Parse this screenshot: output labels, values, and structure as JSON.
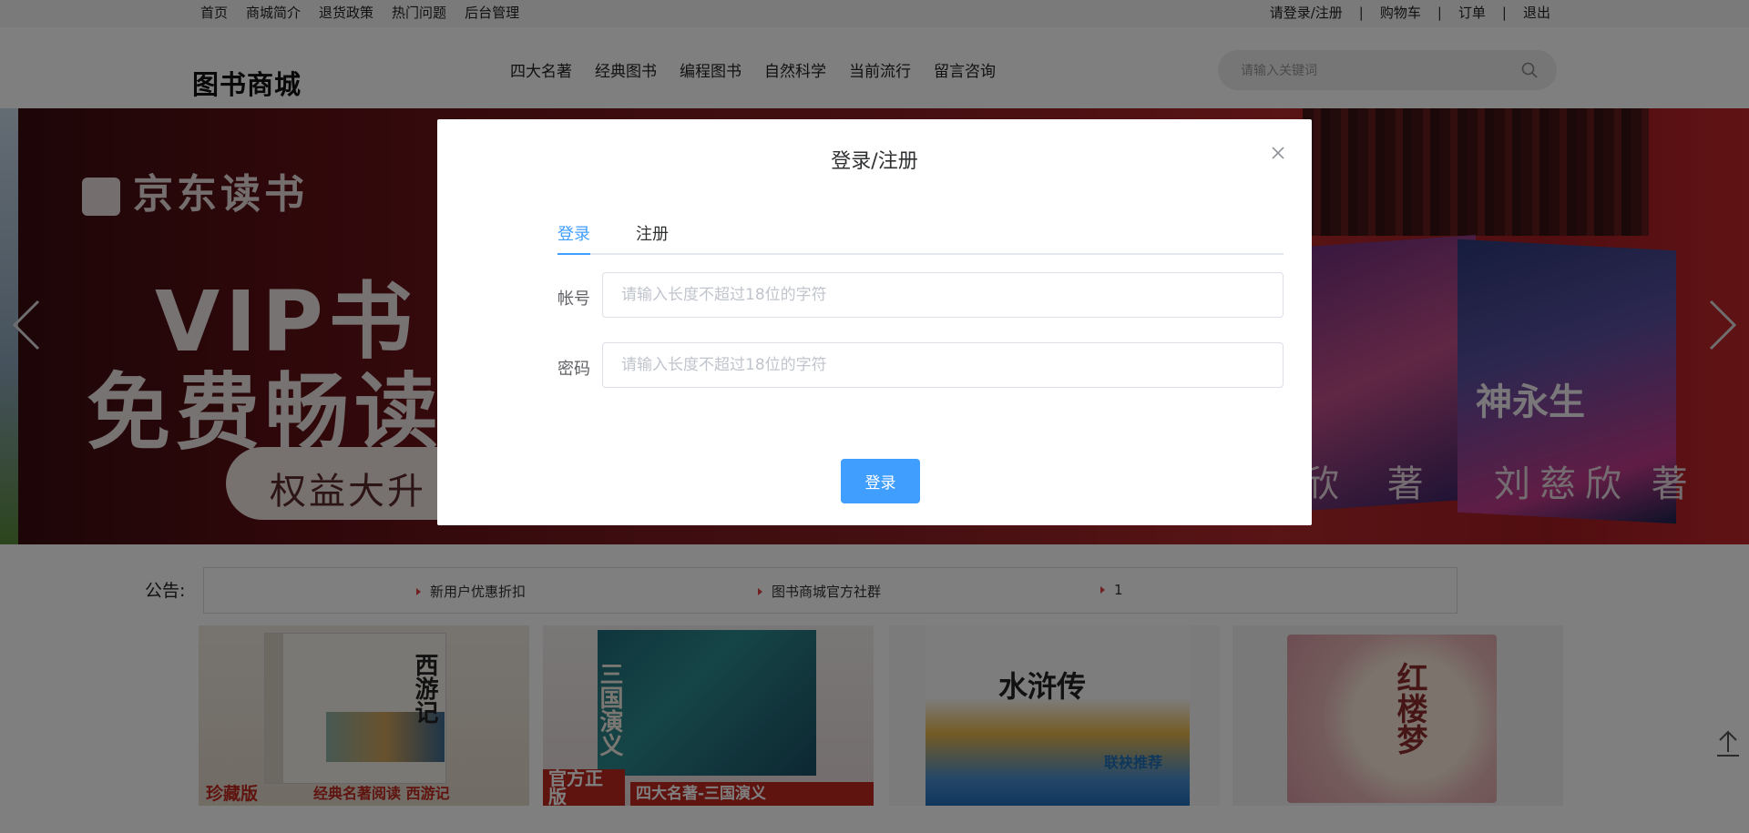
{
  "topbar": {
    "left_links": [
      "首页",
      "商城简介",
      "退货政策",
      "热门问题",
      "后台管理"
    ],
    "right_links": [
      "请登录/注册",
      "购物车",
      "订单",
      "退出"
    ],
    "separator": "|"
  },
  "header": {
    "logo": "图书商城",
    "nav": [
      "四大名著",
      "经典图书",
      "编程图书",
      "自然科学",
      "当前流行",
      "留言咨询"
    ],
    "search": {
      "placeholder": "请输入关键词",
      "icon": "search-icon"
    }
  },
  "banner": {
    "brand": "京东读书",
    "line1": "VIP书",
    "line2": "免费畅读",
    "pill": "权益大升",
    "right_text_1": "欣 著",
    "right_text_2": "刘慈欣 著",
    "right_text_3": "神永生",
    "arrows": [
      "chevron-left-icon",
      "chevron-right-icon"
    ]
  },
  "notice": {
    "label": "公告:",
    "items": [
      "新用户优惠折扣",
      "图书商城官方社群",
      "1"
    ]
  },
  "books": [
    {
      "title": "西游记",
      "tag": "珍藏版",
      "caption": "经典名著阅读 西游记",
      "color": "#c0281e"
    },
    {
      "title": "三国演义",
      "tag": "官方正版",
      "caption": "四大名著-三国演义",
      "color": "#c0281e"
    },
    {
      "title": "水浒传",
      "tag": "",
      "caption": "联袂推荐",
      "color": "#1f6fb8"
    },
    {
      "title": "红楼梦",
      "tag": "",
      "caption": "",
      "color": "#b04a5a"
    }
  ],
  "dialog": {
    "title": "登录/注册",
    "tabs": [
      "登录",
      "注册"
    ],
    "active_tab": "登录",
    "account_label": "帐号",
    "account_placeholder": "请输入长度不超过18位的字符",
    "password_label": "密码",
    "password_placeholder": "请输入长度不超过18位的字符",
    "submit_label": "登录",
    "accent": "#409eff"
  },
  "back_to_top_icon": "arrow-up-icon"
}
